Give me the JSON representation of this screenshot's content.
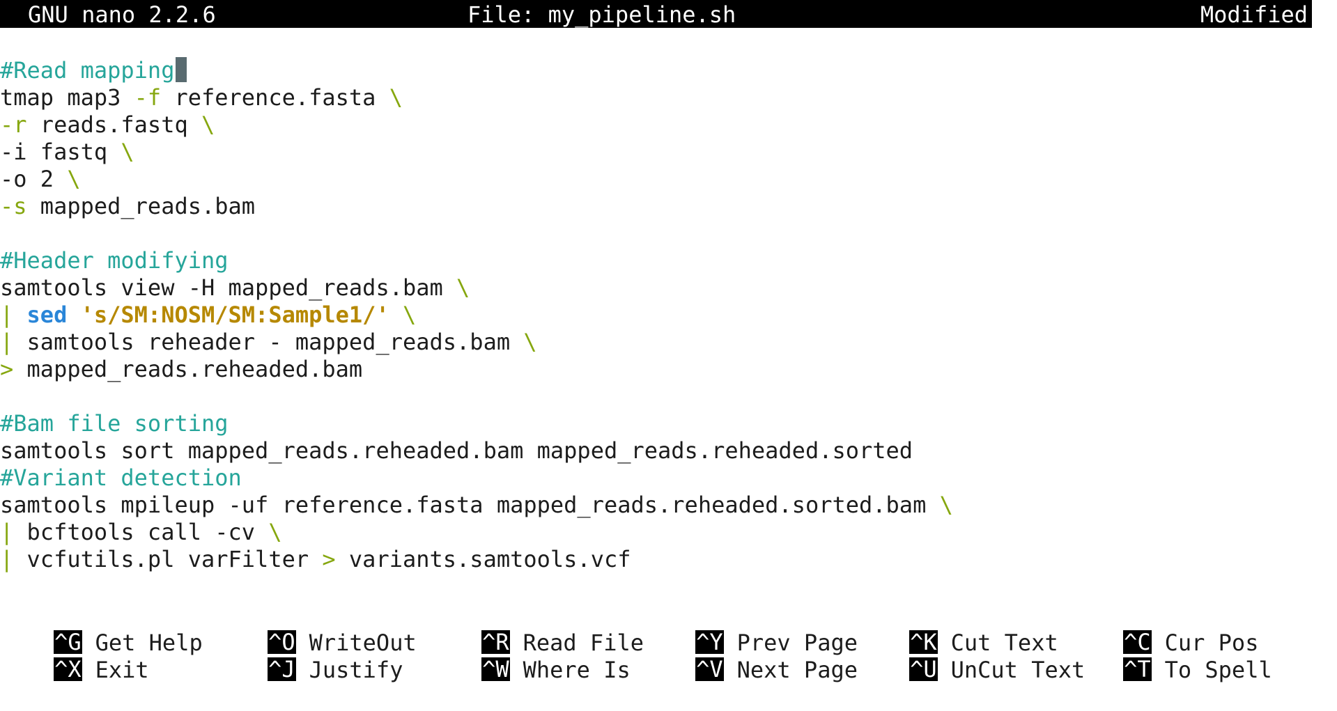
{
  "titlebar": {
    "version": "GNU nano 2.2.6",
    "file": "File: my_pipeline.sh",
    "status": "Modified"
  },
  "editor": {
    "lines": [
      [
        {
          "text": "#Read mapping",
          "style": "cm"
        },
        {
          "cursor": true
        }
      ],
      [
        {
          "text": "tmap map3 "
        },
        {
          "text": "-f",
          "style": "fl"
        },
        {
          "text": " reference.fasta "
        },
        {
          "text": "\\",
          "style": "fl"
        }
      ],
      [
        {
          "text": "-r",
          "style": "fl"
        },
        {
          "text": " reads.fastq "
        },
        {
          "text": "\\",
          "style": "fl"
        }
      ],
      [
        {
          "text": "-i fastq "
        },
        {
          "text": "\\",
          "style": "fl"
        }
      ],
      [
        {
          "text": "-o 2 "
        },
        {
          "text": "\\",
          "style": "fl"
        }
      ],
      [
        {
          "text": "-s",
          "style": "fl"
        },
        {
          "text": " mapped_reads.bam"
        }
      ],
      [],
      [
        {
          "text": "#Header modifying",
          "style": "cm"
        }
      ],
      [
        {
          "text": "samtools view -H mapped_reads.bam "
        },
        {
          "text": "\\",
          "style": "fl"
        }
      ],
      [
        {
          "text": "|",
          "style": "fl"
        },
        {
          "text": " "
        },
        {
          "text": "sed",
          "style": "kw"
        },
        {
          "text": " "
        },
        {
          "text": "'s/SM:NOSM/SM:Sample1/'",
          "style": "str"
        },
        {
          "text": " "
        },
        {
          "text": "\\",
          "style": "fl"
        }
      ],
      [
        {
          "text": "|",
          "style": "fl"
        },
        {
          "text": " samtools reheader - mapped_reads.bam "
        },
        {
          "text": "\\",
          "style": "fl"
        }
      ],
      [
        {
          "text": ">",
          "style": "fl"
        },
        {
          "text": " mapped_reads.reheaded.bam"
        }
      ],
      [],
      [
        {
          "text": "#Bam file sorting",
          "style": "cm"
        }
      ],
      [
        {
          "text": "samtools sort mapped_reads.reheaded.bam mapped_reads.reheaded.sorted"
        }
      ],
      [
        {
          "text": "#Variant detection",
          "style": "cm"
        }
      ],
      [
        {
          "text": "samtools mpileup -uf reference.fasta mapped_reads.reheaded.sorted.bam "
        },
        {
          "text": "\\",
          "style": "fl"
        }
      ],
      [
        {
          "text": "|",
          "style": "fl"
        },
        {
          "text": " bcftools call -cv "
        },
        {
          "text": "\\",
          "style": "fl"
        }
      ],
      [
        {
          "text": "|",
          "style": "fl"
        },
        {
          "text": " vcfutils.pl varFilter "
        },
        {
          "text": ">",
          "style": "fl"
        },
        {
          "text": " variants.samtools.vcf"
        }
      ]
    ]
  },
  "shortcuts": {
    "row1": [
      {
        "key": "^G",
        "label": "Get Help"
      },
      {
        "key": "^O",
        "label": "WriteOut"
      },
      {
        "key": "^R",
        "label": "Read File"
      },
      {
        "key": "^Y",
        "label": "Prev Page"
      },
      {
        "key": "^K",
        "label": "Cut Text"
      },
      {
        "key": "^C",
        "label": "Cur Pos"
      }
    ],
    "row2": [
      {
        "key": "^X",
        "label": "Exit"
      },
      {
        "key": "^J",
        "label": "Justify"
      },
      {
        "key": "^W",
        "label": "Where Is"
      },
      {
        "key": "^V",
        "label": "Next Page"
      },
      {
        "key": "^U",
        "label": "UnCut Text"
      },
      {
        "key": "^T",
        "label": "To Spell"
      }
    ]
  }
}
